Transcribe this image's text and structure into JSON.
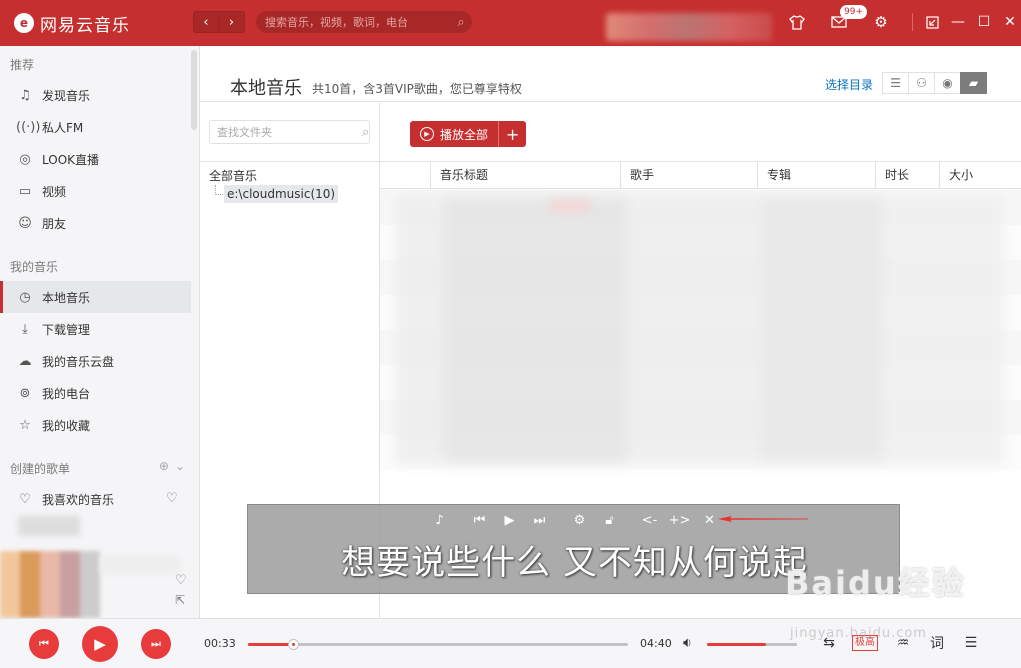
{
  "app": {
    "name": "网易云音乐",
    "logo_glyph": "e"
  },
  "topbar": {
    "back_glyph": "‹",
    "forward_glyph": "›",
    "search_placeholder": "搜索音乐，视频，歌词，电台",
    "mail_badge": "99+"
  },
  "sidebar": {
    "section_recommend": "推荐",
    "items_recommend": [
      {
        "label": "发现音乐",
        "icon": "music-note-icon"
      },
      {
        "label": "私人FM",
        "icon": "radio-waves-icon"
      },
      {
        "label": "LOOK直播",
        "icon": "live-icon"
      },
      {
        "label": "视频",
        "icon": "video-icon"
      },
      {
        "label": "朋友",
        "icon": "friends-icon"
      }
    ],
    "section_my_music": "我的音乐",
    "items_my_music": [
      {
        "label": "本地音乐",
        "icon": "local-music-icon"
      },
      {
        "label": "下载管理",
        "icon": "download-icon"
      },
      {
        "label": "我的音乐云盘",
        "icon": "cloud-icon"
      },
      {
        "label": "我的电台",
        "icon": "podcast-icon"
      },
      {
        "label": "我的收藏",
        "icon": "collect-icon"
      }
    ],
    "section_created": "创建的歌单",
    "items_created": [
      {
        "label": "我喜欢的音乐",
        "icon": "heart-icon"
      }
    ]
  },
  "main": {
    "title": "本地音乐",
    "subtitle": "共10首，含3首VIP歌曲，您已尊享特权",
    "select_dir": "选择目录",
    "folder_search_placeholder": "查找文件夹",
    "tree_root": "全部音乐",
    "tree_child": "e:\\cloudmusic(10)",
    "play_all": "播放全部",
    "columns": [
      "音乐标题",
      "歌手",
      "专辑",
      "时长",
      "大小"
    ]
  },
  "lyric": {
    "text": "想要说些什么 又不知从何说起"
  },
  "player": {
    "current_time": "00:33",
    "total_time": "04:40",
    "progress": 0.118,
    "volume": 0.65,
    "quality_label": "极高"
  },
  "watermark": {
    "main": "Baidu经验",
    "sub": "jingyan.baidu.com"
  },
  "colors": {
    "brand": "#c62f2f",
    "accent_red": "#e83c3c",
    "link_blue": "#0c73c2"
  }
}
